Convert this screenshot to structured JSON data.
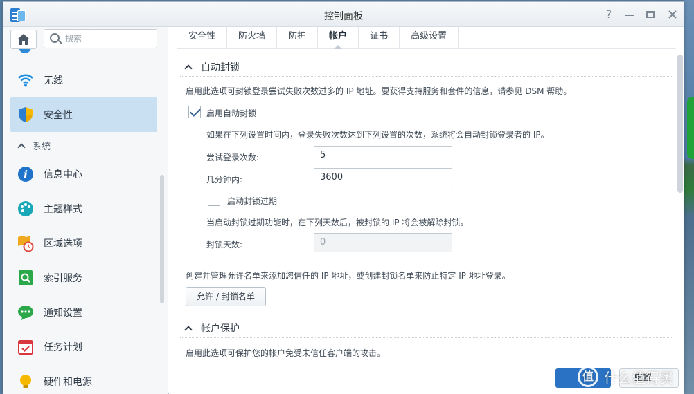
{
  "window": {
    "title": "控制面板"
  },
  "sidebar": {
    "search_placeholder": "搜索",
    "items_top": [
      {
        "label": "无线"
      },
      {
        "label": "安全性"
      }
    ],
    "section_label": "系统",
    "items": [
      {
        "label": "信息中心"
      },
      {
        "label": "主题样式"
      },
      {
        "label": "区域选项"
      },
      {
        "label": "索引服务"
      },
      {
        "label": "通知设置"
      },
      {
        "label": "任务计划"
      },
      {
        "label": "硬件和电源"
      }
    ]
  },
  "tabs": [
    "安全性",
    "防火墙",
    "防护",
    "帐户",
    "证书",
    "高级设置"
  ],
  "active_tab": "帐户",
  "auto_block": {
    "header": "自动封锁",
    "desc": "启用此选项可封锁登录尝试失败次数过多的 IP 地址。要获得支持服务和套件的信息，请参见 DSM 帮助。",
    "enable_label": "启用自动封锁",
    "enable_checked": true,
    "rule_desc": "如果在下列设置时间内，登录失败次数达到下列设置的次数，系统将会自动封锁登录者的 IP。",
    "attempts_label": "尝试登录次数:",
    "attempts_value": "5",
    "minutes_label": "几分钟内:",
    "minutes_value": "3600",
    "expire_label": "启动封锁过期",
    "expire_checked": false,
    "expire_desc": "当启动封锁过期功能时，在下列天数后，被封锁的 IP 将会被解除封锁。",
    "days_label": "封锁天数:",
    "days_value": "0",
    "list_desc": "创建并管理允许名单来添加您信任的 IP 地址，或创建封锁名单来防止特定 IP 地址登录。",
    "list_button": "允许 / 封锁名单"
  },
  "account_protection": {
    "header": "帐户保护",
    "desc": "启用此选项可保护您的帐户免受未信任客户端的攻击。"
  },
  "footer": {
    "reset_label": "重置",
    "watermark": "什么值得买",
    "watermark_logo": "值"
  },
  "colors": {
    "accent": "#2a73c4",
    "active_nav": "#c9dff2"
  }
}
